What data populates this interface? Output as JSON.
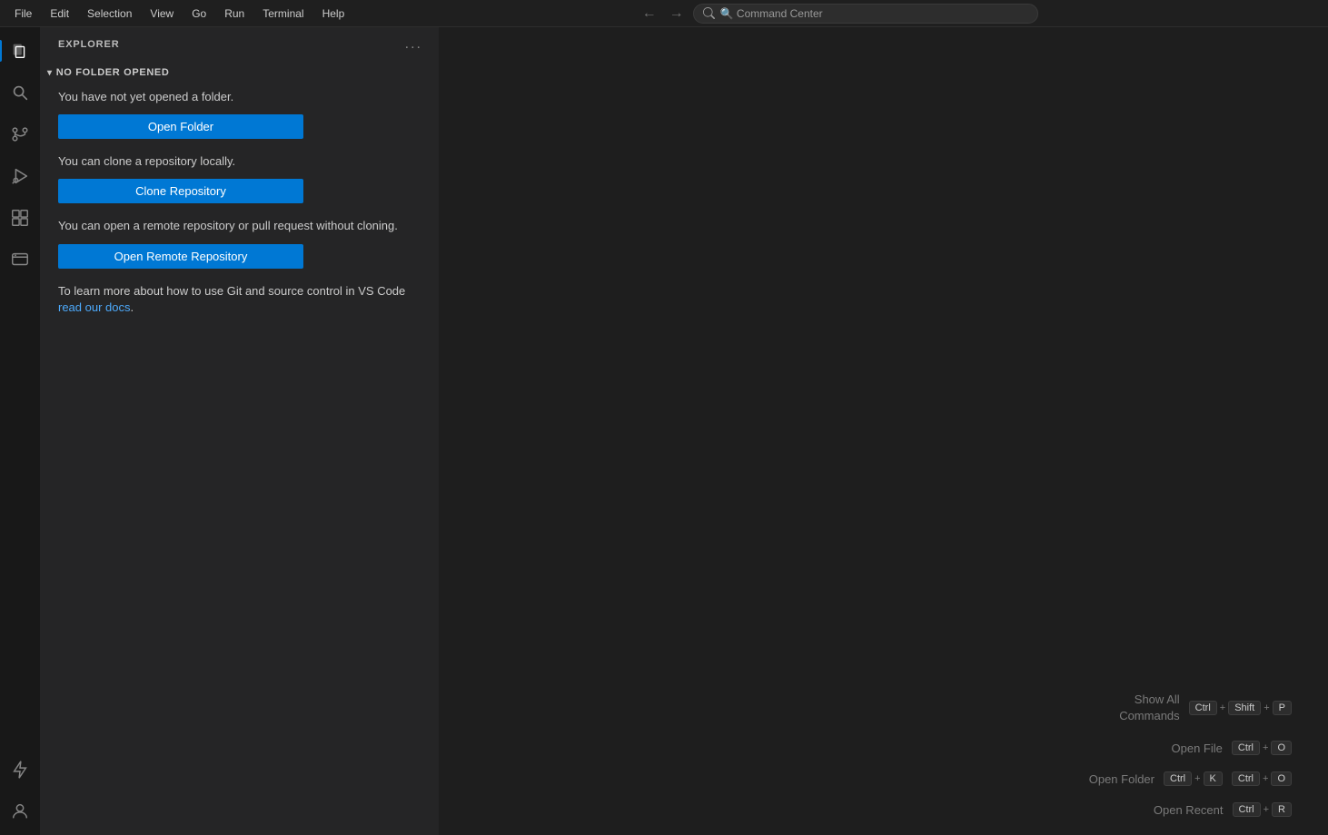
{
  "titlebar": {
    "menu_items": [
      "File",
      "Edit",
      "Selection",
      "View",
      "Go",
      "Run",
      "Terminal",
      "Help"
    ],
    "nav_back_label": "←",
    "nav_forward_label": "→",
    "command_center_placeholder": "🔍 Command Center"
  },
  "activity_bar": {
    "icons": [
      {
        "name": "explorer-icon",
        "label": "Explorer",
        "active": true
      },
      {
        "name": "search-icon",
        "label": "Search",
        "active": false
      },
      {
        "name": "source-control-icon",
        "label": "Source Control",
        "active": false
      },
      {
        "name": "run-debug-icon",
        "label": "Run and Debug",
        "active": false
      },
      {
        "name": "extensions-icon",
        "label": "Extensions",
        "active": false
      },
      {
        "name": "remote-explorer-icon",
        "label": "Remote Explorer",
        "active": false
      },
      {
        "name": "thunder-icon",
        "label": "Flash",
        "active": false
      },
      {
        "name": "account-icon",
        "label": "Account",
        "active": false
      }
    ]
  },
  "sidebar": {
    "title": "EXPLORER",
    "more_actions_label": "...",
    "section": {
      "label": "NO FOLDER OPENED",
      "body": {
        "open_folder_desc": "You have not yet opened a folder.",
        "open_folder_btn": "Open Folder",
        "clone_desc": "You can clone a repository locally.",
        "clone_btn": "Clone Repository",
        "remote_desc": "You can open a remote repository or pull request without cloning.",
        "remote_btn": "Open Remote Repository",
        "docs_text": "To learn more about how to use Git and source control in VS Code",
        "docs_link_text": "read our docs",
        "docs_suffix": "."
      }
    }
  },
  "shortcuts": [
    {
      "label": "Show All\nCommands",
      "keys": [
        {
          "parts": [
            "Ctrl",
            "+",
            "Shift",
            "+",
            "P"
          ]
        }
      ]
    },
    {
      "label": "Open File",
      "keys": [
        {
          "parts": [
            "Ctrl",
            "+",
            "O"
          ]
        }
      ]
    },
    {
      "label": "Open Folder",
      "keys": [
        {
          "parts": [
            "Ctrl",
            "+",
            "K"
          ]
        },
        {
          "parts": [
            "Ctrl",
            "+",
            "O"
          ]
        }
      ]
    },
    {
      "label": "Open Recent",
      "keys": [
        {
          "parts": [
            "Ctrl",
            "+",
            "R"
          ]
        }
      ]
    }
  ]
}
